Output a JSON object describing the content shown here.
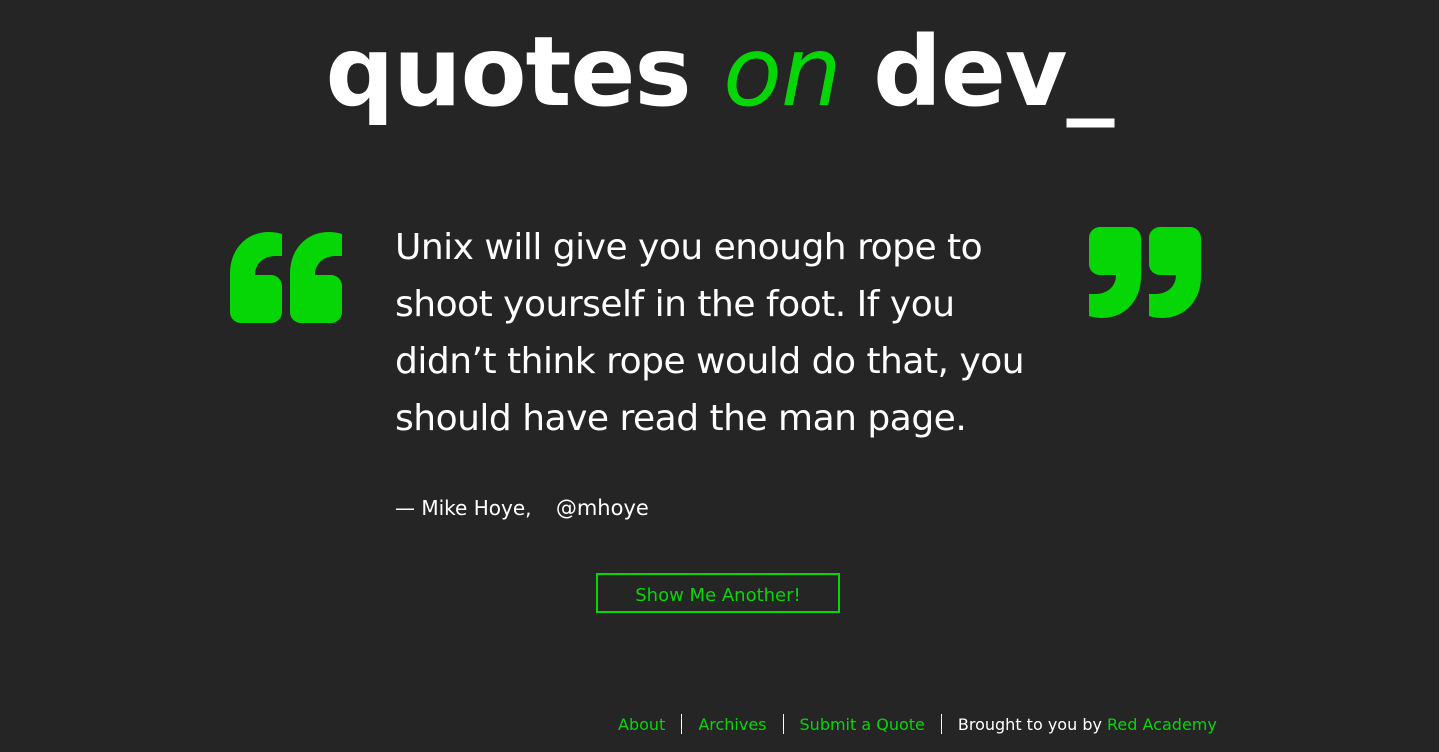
{
  "header": {
    "logo_part1": "quotes",
    "logo_part2": "on",
    "logo_part3": "dev",
    "logo_cursor": "_"
  },
  "quote": {
    "text": "Unix will give you enough rope to shoot yourself in the foot. If you didn’t think rope would do that, you should have read the man page.",
    "author": "— Mike Hoye,",
    "source": "@mhoye"
  },
  "actions": {
    "another_label": "Show Me Another!"
  },
  "footer": {
    "about": "About",
    "archives": "Archives",
    "submit": "Submit a Quote",
    "credit_prefix": "Brought to you by",
    "credit_link": "Red Academy"
  },
  "colors": {
    "accent": "#06d606",
    "background": "#252525",
    "text": "#ffffff"
  },
  "icons": {
    "open_quote": "open-quote-icon",
    "close_quote": "close-quote-icon"
  }
}
